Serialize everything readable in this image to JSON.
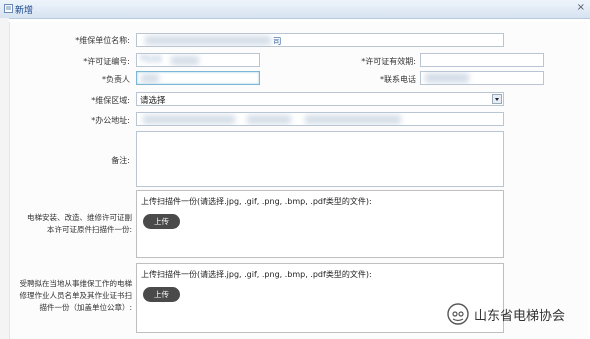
{
  "window": {
    "title": "新增",
    "close": "×"
  },
  "form": {
    "unit_name_label": "*维保单位名称:",
    "unit_name_value": "司",
    "license_no_label": "*许可证编号:",
    "license_no_value": "TS33",
    "license_valid_label": "*许可证有效期:",
    "license_valid_value": "",
    "owner_label": "*负责人",
    "owner_value": "",
    "phone_label": "*联系电话",
    "phone_value": "",
    "area_label": "*维保区域:",
    "area_value": "请选择",
    "address_label": "*办公地址:",
    "address_value": "",
    "note_label": "备注:",
    "note_value": ""
  },
  "uploads": [
    {
      "label_lines": [
        "电梯安装、改造、维修许可证副",
        "本许可证原件扫描件一份:"
      ],
      "hint": "上传扫描件一份(请选择.jpg, .gif, .png, .bmp, .pdf类型的文件):",
      "button": "上传"
    },
    {
      "label_lines": [
        "受聘拟在当地从事维保工作的电梯",
        "修理作业人员名单及其作业证书扫",
        "描件一份（加盖单位公章）:"
      ],
      "hint": "上传扫描件一份(请选择.jpg, .gif, .png, .bmp, .pdf类型的文件):",
      "button": "上传"
    }
  ],
  "watermark": {
    "text": "山东省电梯协会"
  }
}
